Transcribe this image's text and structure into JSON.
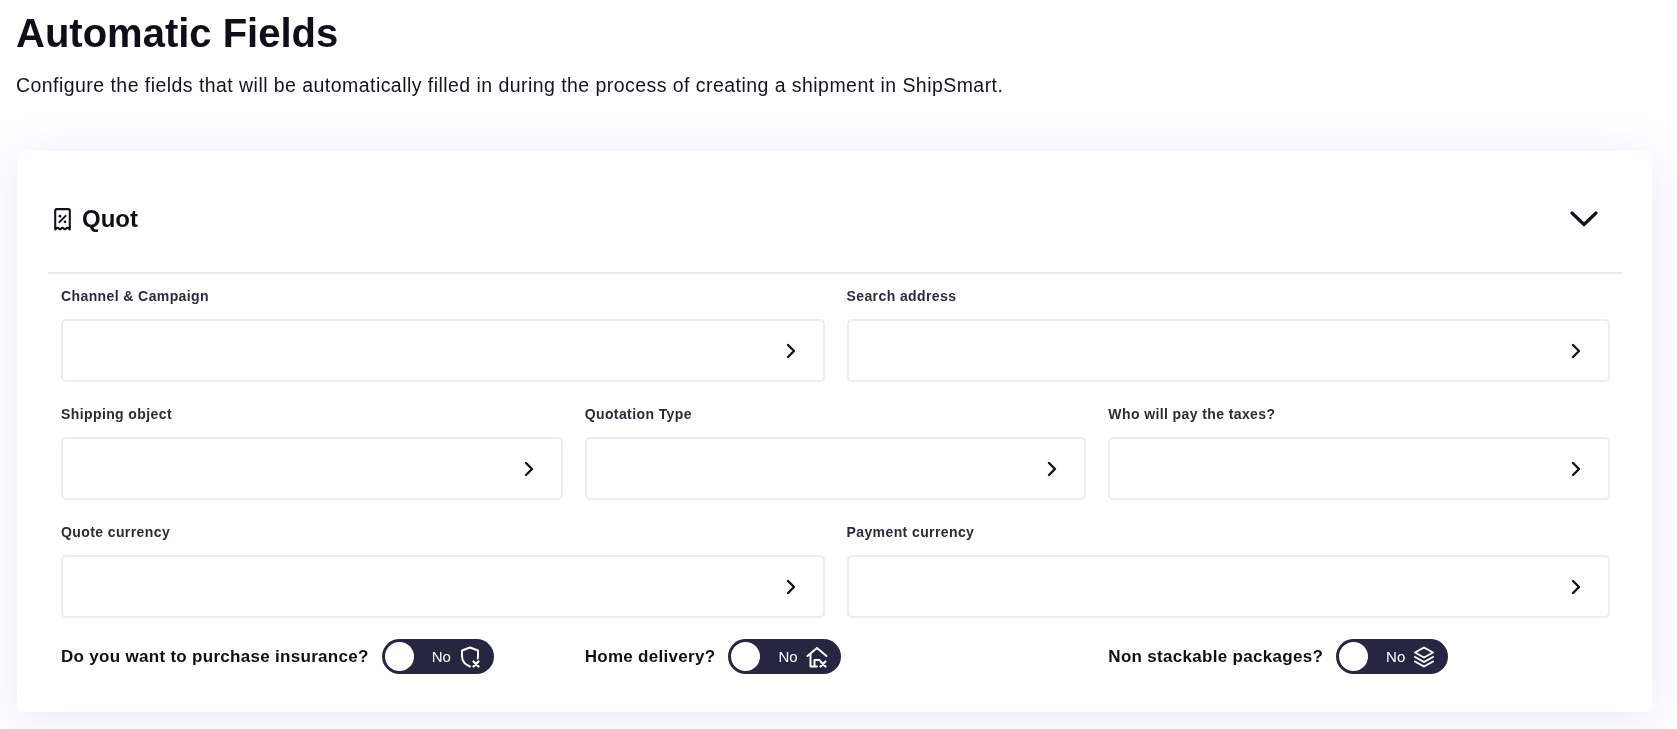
{
  "page": {
    "title": "Automatic Fields",
    "description": "Configure the fields that will be automatically filled in during the process of creating a shipment in ShipSmart."
  },
  "section": {
    "title": "Quot",
    "expanded": true,
    "field_rows": [
      {
        "fields": [
          {
            "label": "Channel & Campaign"
          },
          {
            "label": "Search address"
          }
        ]
      },
      {
        "fields": [
          {
            "label": "Shipping object"
          },
          {
            "label": "Quotation Type"
          },
          {
            "label": "Who will pay the taxes?"
          }
        ]
      },
      {
        "fields": [
          {
            "label": "Quote currency"
          },
          {
            "label": "Payment currency"
          }
        ]
      }
    ],
    "toggles": [
      {
        "label": "Do you want to purchase insurance?",
        "on": false,
        "state_text": "No"
      },
      {
        "label": "Home delivery?",
        "on": false,
        "state_text": "No"
      },
      {
        "label": "Non stackable packages?",
        "on": false,
        "state_text": "No"
      }
    ]
  }
}
